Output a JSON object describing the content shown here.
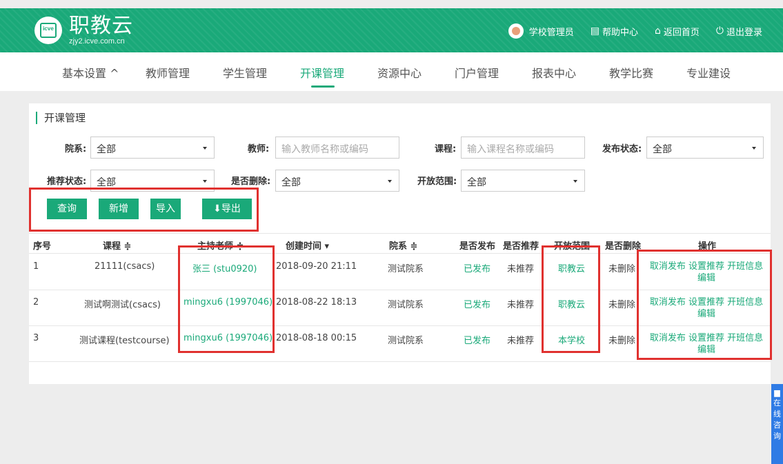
{
  "header": {
    "logo_title": "职教云",
    "logo_sub": "zjy2.icve.com.cn",
    "logo_badge": "icve",
    "user": "学校管理员",
    "help": "帮助中心",
    "home": "返回首页",
    "logout": "退出登录"
  },
  "nav": {
    "items": [
      "基本设置 ^",
      "教师管理",
      "学生管理",
      "开课管理",
      "资源中心",
      "门户管理",
      "报表中心",
      "教学比赛",
      "专业建设"
    ],
    "active": "开课管理"
  },
  "panel": {
    "title": "开课管理"
  },
  "filters": {
    "department_label": "院系:",
    "department_value": "全部",
    "teacher_label": "教师:",
    "teacher_placeholder": "输入教师名称或编码",
    "course_label": "课程:",
    "course_placeholder": "输入课程名称或编码",
    "publish_label": "发布状态:",
    "publish_value": "全部",
    "recommend_label": "推荐状态:",
    "recommend_value": "全部",
    "deleted_label": "是否删除:",
    "deleted_value": "全部",
    "scope_label": "开放范围:",
    "scope_value": "全部"
  },
  "buttons": {
    "query": "查询",
    "add": "新增",
    "import": "导入",
    "export": "导出"
  },
  "table": {
    "headers": [
      "序号",
      "课程 ≑",
      "主持老师 ≑",
      "创建时间 ▾",
      "院系 ≑",
      "是否发布",
      "是否推荐",
      "开放范围",
      "是否删除",
      "操作"
    ],
    "rows": [
      {
        "no": "1",
        "course": "21111(csacs)",
        "teacher": "张三 (stu0920)",
        "created": "2018-09-20 21:11",
        "dept": "测试院系",
        "published": "已发布",
        "recommended": "未推荐",
        "scope": "职教云",
        "deleted": "未删除",
        "ops_line1": "取消发布 设置推荐 开班信息",
        "ops_line2": "编辑"
      },
      {
        "no": "2",
        "course": "测试啊测试(csacs)",
        "teacher": "mingxu6 (1997046)",
        "created": "2018-08-22 18:13",
        "dept": "测试院系",
        "published": "已发布",
        "recommended": "未推荐",
        "scope": "职教云",
        "deleted": "未删除",
        "ops_line1": "取消发布 设置推荐 开班信息",
        "ops_line2": "编辑"
      },
      {
        "no": "3",
        "course": "测试课程(testcourse)",
        "teacher": "mingxu6 (1997046)",
        "created": "2018-08-18 00:15",
        "dept": "测试院系",
        "published": "已发布",
        "recommended": "未推荐",
        "scope": "本学校",
        "deleted": "未删除",
        "ops_line1": "取消发布 设置推荐 开班信息",
        "ops_line2": "编辑"
      }
    ]
  },
  "side_tab": [
    "在",
    "线",
    "咨",
    "询"
  ],
  "colors": {
    "brand": "#1aa979",
    "highlight": "#e0312f",
    "side": "#2f7be5"
  },
  "icons": [
    "avatar-icon",
    "help-icon",
    "home-icon",
    "power-icon",
    "download-icon",
    "sort-icon",
    "chevron-down-icon"
  ]
}
